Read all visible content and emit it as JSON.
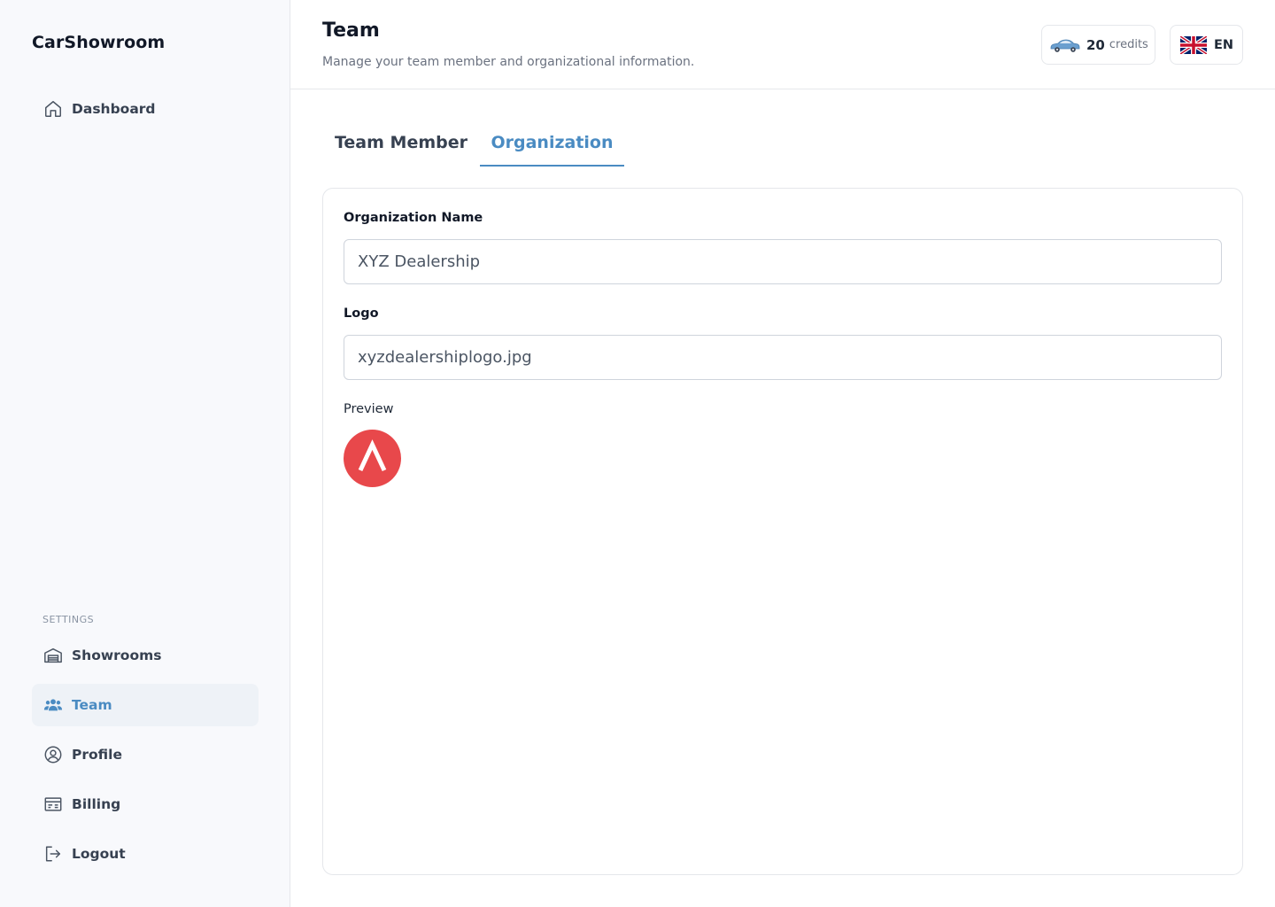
{
  "sidebar": {
    "brand": "CarShowroom",
    "dashboard_label": "Dashboard",
    "settings_label": "SETTINGS",
    "items": [
      {
        "label": "Showrooms",
        "icon": "showroom-icon"
      },
      {
        "label": "Team",
        "icon": "team-icon",
        "active": true
      },
      {
        "label": "Profile",
        "icon": "profile-icon"
      },
      {
        "label": "Billing",
        "icon": "billing-icon"
      },
      {
        "label": "Logout",
        "icon": "logout-icon"
      }
    ]
  },
  "header": {
    "title": "Team",
    "subtitle": "Manage your team member and organizational information.",
    "credits_count": "20",
    "credits_label": "credits",
    "language": "EN"
  },
  "tabs": [
    {
      "label": "Team Member",
      "active": false
    },
    {
      "label": "Organization",
      "active": true
    }
  ],
  "form": {
    "org_name_label": "Organization Name",
    "org_name_value": "XYZ Dealership",
    "logo_label": "Logo",
    "logo_value": "xyzdealershiplogo.jpg",
    "preview_label": "Preview"
  },
  "colors": {
    "accent": "#4a8bc2",
    "logo_red": "#e8484b",
    "sidebar_bg": "#f8f9fc"
  }
}
